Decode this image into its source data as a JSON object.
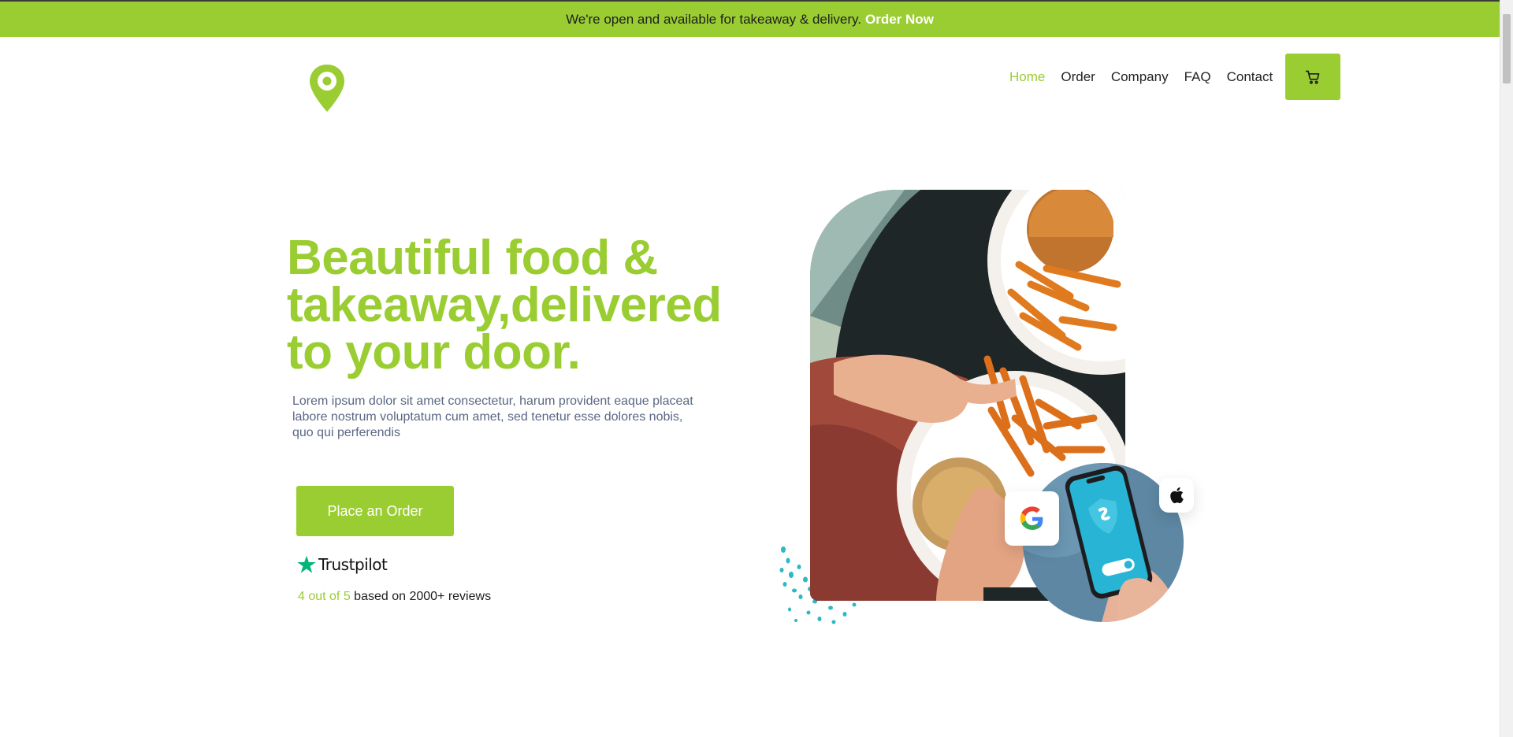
{
  "announcement": {
    "text": "We're open and available for takeaway & delivery.",
    "cta": "Order Now"
  },
  "header": {
    "logo_icon": "map-pin-icon",
    "nav": [
      {
        "label": "Home",
        "active": true
      },
      {
        "label": "Order",
        "active": false
      },
      {
        "label": "Company",
        "active": false
      },
      {
        "label": "FAQ",
        "active": false
      },
      {
        "label": "Contact",
        "active": false
      }
    ],
    "cart_icon": "cart-icon"
  },
  "hero": {
    "title": "Beautiful food & takeaway,delivered to your door.",
    "description": "Lorem ipsum dolor sit amet consectetur, harum provident eaque placeat labore nostrum voluptatum cum amet, sed tenetur esse dolores nobis, quo qui perferendis",
    "button": "Place an Order",
    "trustpilot_brand": "Trustpilot",
    "rating_score": "4 out of 5",
    "rating_suffix": " based on 2000+ reviews"
  },
  "colors": {
    "accent": "#9acd32",
    "body_text": "#5a6784",
    "trustpilot_star": "#00b67a",
    "splash": "#2bb9c4"
  }
}
